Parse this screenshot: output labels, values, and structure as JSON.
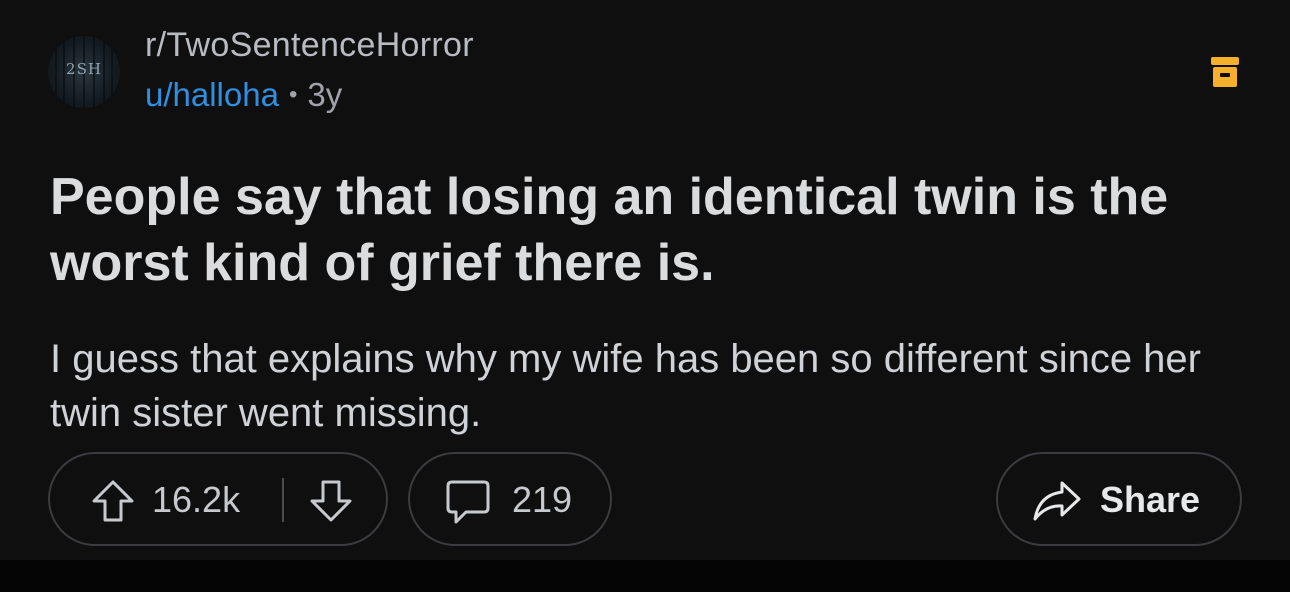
{
  "post": {
    "subreddit": "r/TwoSentenceHorror",
    "avatar_text": "2SH",
    "username": "u/halloha",
    "separator": "•",
    "age": "3y",
    "title": "People say that losing an identical twin is the worst kind of grief there is.",
    "body": "I guess that explains why my wife has been so different since her twin sister went missing."
  },
  "actions": {
    "upvote_count": "16.2k",
    "comment_count": "219",
    "share_label": "Share"
  },
  "icons": {
    "archive": "archive-icon",
    "upvote": "upvote-arrow-icon",
    "downvote": "downvote-arrow-icon",
    "comment": "comment-bubble-icon",
    "share": "share-arrow-icon"
  },
  "colors": {
    "background": "#0f0f10",
    "username": "#2f8fe0",
    "archive_accent": "#f6b02c",
    "title": "#dadcde",
    "body": "#cfd2d6"
  }
}
